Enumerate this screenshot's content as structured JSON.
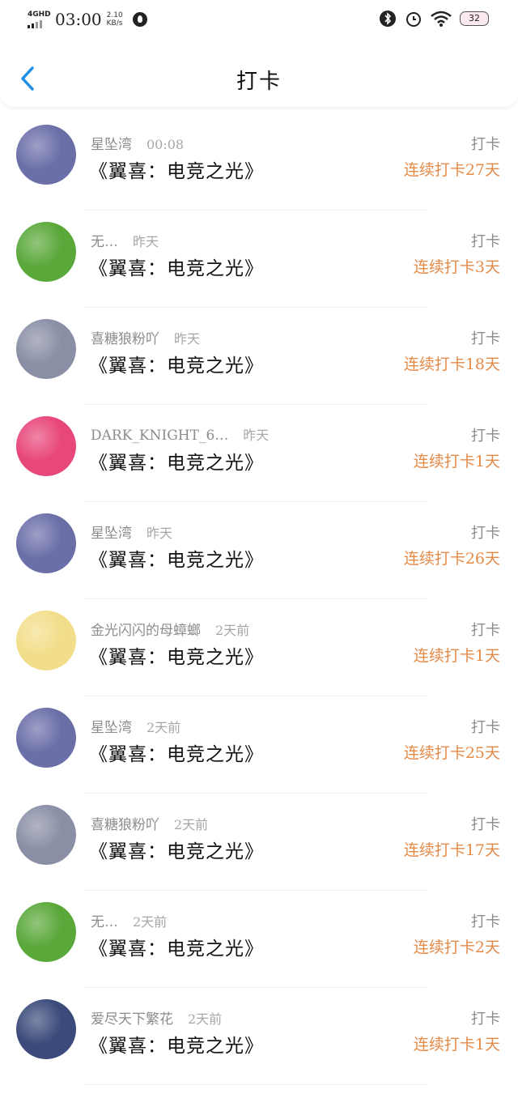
{
  "status_bar": {
    "network": "4GHD",
    "time": "03:00",
    "speed_value": "2.10",
    "speed_unit": "KB/s",
    "battery": "32"
  },
  "header": {
    "title": "打卡"
  },
  "items": [
    {
      "name": "星坠湾",
      "time": "00:08",
      "title": "《翼喜：电竞之光》",
      "label": "打卡",
      "streak": "连续打卡27天",
      "avatar_color": "#6b6fa8"
    },
    {
      "name": "无…",
      "time": "昨天",
      "title": "《翼喜：电竞之光》",
      "label": "打卡",
      "streak": "连续打卡3天",
      "avatar_color": "#5aa83a"
    },
    {
      "name": "喜糖狼粉吖",
      "time": "昨天",
      "title": "《翼喜：电竞之光》",
      "label": "打卡",
      "streak": "连续打卡18天",
      "avatar_color": "#8a8fa6"
    },
    {
      "name": "DARK_KNIGHT_6…",
      "time": "昨天",
      "title": "《翼喜：电竞之光》",
      "label": "打卡",
      "streak": "连续打卡1天",
      "avatar_color": "#e8477a"
    },
    {
      "name": "星坠湾",
      "time": "昨天",
      "title": "《翼喜：电竞之光》",
      "label": "打卡",
      "streak": "连续打卡26天",
      "avatar_color": "#6b6fa8"
    },
    {
      "name": "金光闪闪的母蟑螂",
      "time": "2天前",
      "title": "《翼喜：电竞之光》",
      "label": "打卡",
      "streak": "连续打卡1天",
      "avatar_color": "#f2de8a"
    },
    {
      "name": "星坠湾",
      "time": "2天前",
      "title": "《翼喜：电竞之光》",
      "label": "打卡",
      "streak": "连续打卡25天",
      "avatar_color": "#6b6fa8"
    },
    {
      "name": "喜糖狼粉吖",
      "time": "2天前",
      "title": "《翼喜：电竞之光》",
      "label": "打卡",
      "streak": "连续打卡17天",
      "avatar_color": "#8a8fa6"
    },
    {
      "name": "无…",
      "time": "2天前",
      "title": "《翼喜：电竞之光》",
      "label": "打卡",
      "streak": "连续打卡2天",
      "avatar_color": "#5aa83a"
    },
    {
      "name": "爱尽天下繁花",
      "time": "2天前",
      "title": "《翼喜：电竞之光》",
      "label": "打卡",
      "streak": "连续打卡1天",
      "avatar_color": "#3b4a7a"
    }
  ]
}
